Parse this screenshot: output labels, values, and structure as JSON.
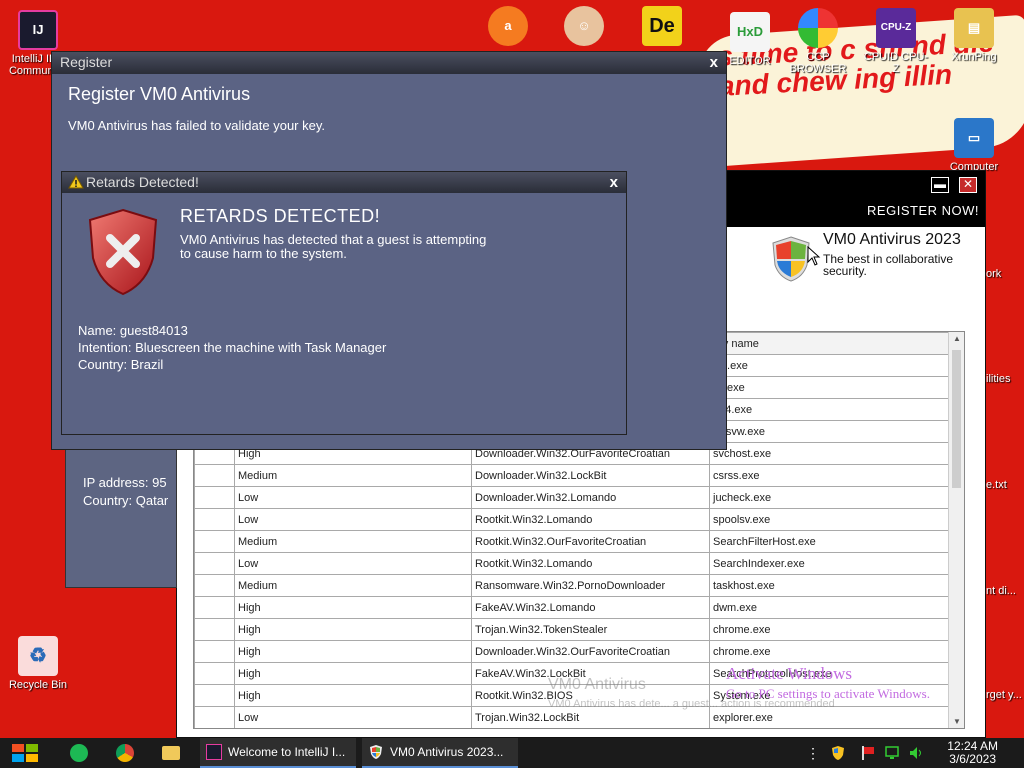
{
  "desktop": {
    "icons": [
      {
        "label": "IntelliJ IDE Communi…",
        "icon": "intellij-icon"
      },
      {
        "label": "",
        "icon": "avast-icon"
      },
      {
        "label": "",
        "icon": "user-doctor-icon"
      },
      {
        "label": "",
        "icon": "de-icon"
      },
      {
        "label": "EDITOR",
        "icon": "hxd-editor-icon"
      },
      {
        "label": "CCP BROWSER",
        "icon": "ccp-browser-icon"
      },
      {
        "label": "CPUID CPU-Z",
        "icon": "cpuz-icon"
      },
      {
        "label": "XrunPing",
        "icon": "xrunping-icon"
      },
      {
        "label": "Computer",
        "icon": "computer-icon"
      },
      {
        "label": "Recycle Bin",
        "icon": "recycle-bin-icon"
      }
    ],
    "wallpaper_text": "s time to c shi nd die and chew ing illin",
    "right_edge_labels": [
      "ork",
      "ilities",
      "e.txt",
      "nt di...",
      "rget y..."
    ]
  },
  "av_window": {
    "register_now": "REGISTER NOW!",
    "minimize": "▬",
    "close": "✕",
    "brand_title": "VM0 Antivirus 2023",
    "brand_tagline": "The best in collaborative security.",
    "table": {
      "col_header_visible": "ary name",
      "rows": [
        {
          "severity": "",
          "threat": "",
          "process": "init.exe"
        },
        {
          "severity": "",
          "threat": "",
          "process": "ss.exe"
        },
        {
          "severity": "",
          "threat": "",
          "process": "a64.exe"
        },
        {
          "severity": "",
          "threat": "",
          "process": "torsvw.exe"
        },
        {
          "severity": "High",
          "threat": "Downloader.Win32.OurFavoriteCroatian",
          "process": "svchost.exe"
        },
        {
          "severity": "Medium",
          "threat": "Downloader.Win32.LockBit",
          "process": "csrss.exe"
        },
        {
          "severity": "Low",
          "threat": "Downloader.Win32.Lomando",
          "process": "jucheck.exe"
        },
        {
          "severity": "Low",
          "threat": "Rootkit.Win32.Lomando",
          "process": "spoolsv.exe"
        },
        {
          "severity": "Medium",
          "threat": "Rootkit.Win32.OurFavoriteCroatian",
          "process": "SearchFilterHost.exe"
        },
        {
          "severity": "Low",
          "threat": "Rootkit.Win32.Lomando",
          "process": "SearchIndexer.exe"
        },
        {
          "severity": "Medium",
          "threat": "Ransomware.Win32.PornoDownloader",
          "process": "taskhost.exe"
        },
        {
          "severity": "High",
          "threat": "FakeAV.Win32.Lomando",
          "process": "dwm.exe"
        },
        {
          "severity": "High",
          "threat": "Trojan.Win32.TokenStealer",
          "process": "chrome.exe"
        },
        {
          "severity": "High",
          "threat": "Downloader.Win32.OurFavoriteCroatian",
          "process": "chrome.exe"
        },
        {
          "severity": "High",
          "threat": "FakeAV.Win32.LockBit",
          "process": "SearchProtocolHost.exe"
        },
        {
          "severity": "High",
          "threat": "Rootkit.Win32.BIOS",
          "process": "System.exe"
        },
        {
          "severity": "Low",
          "threat": "Trojan.Win32.LockBit",
          "process": "explorer.exe"
        }
      ]
    }
  },
  "info_panel": {
    "ip_label": "IP address: 95",
    "country_label": "Country: Qatar"
  },
  "register_dialog": {
    "title": "Register",
    "close": "x",
    "heading": "Register VM0 Antivirus",
    "message": "VM0 Antivirus has failed to validate your key."
  },
  "detect_dialog": {
    "title": "Retards Detected!",
    "close": "x",
    "heading": "RETARDS DETECTED!",
    "message_line1": "VM0 Antivirus has detected that a guest is attempting",
    "message_line2": "to cause harm to the system.",
    "name": "Name: guest84013",
    "intention": "Intention: Bluescreen the machine with Task Manager",
    "country": "Country: Brazil"
  },
  "toast_ghost": {
    "title": "VM0 Antivirus",
    "line": "VM0 Antivirus has dete... a guest... action is recommended"
  },
  "watermark": {
    "line1": "Activate Windows",
    "line2": "Go to PC settings to activate Windows."
  },
  "taskbar": {
    "apps": [
      {
        "label": "Welcome to IntelliJ I...",
        "icon": "intellij-icon"
      },
      {
        "label": "VM0 Antivirus 2023...",
        "icon": "shield-icon"
      }
    ],
    "time": "12:24 AM",
    "date": "3/6/2023"
  },
  "colors": {
    "desktop_bg": "#d9180f",
    "dialog_bg": "#5b6384",
    "av_header": "#000000",
    "taskbar": "#1b1b1b",
    "watermark": "#c26be0"
  }
}
